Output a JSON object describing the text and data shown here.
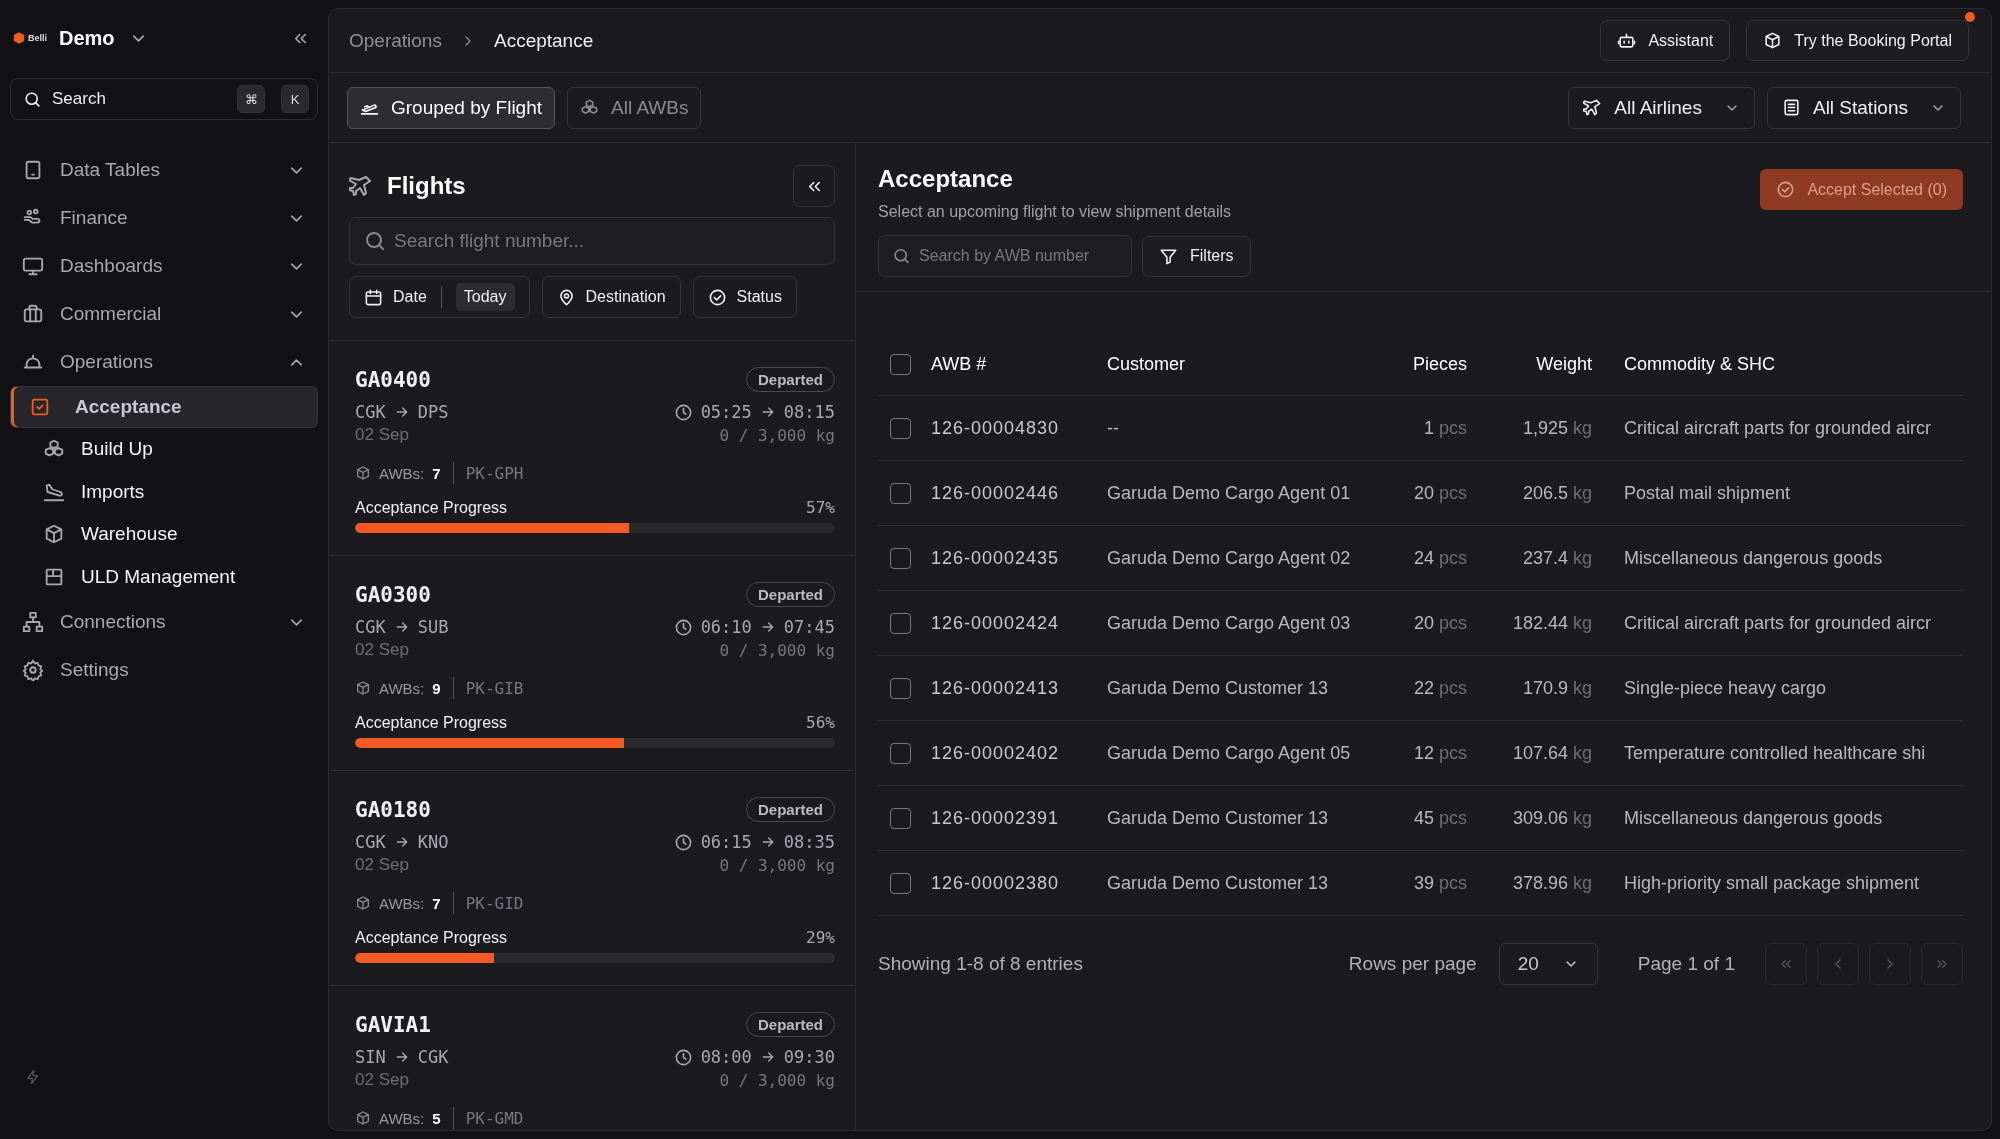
{
  "sidebar": {
    "brand": {
      "logo_text": "Belli",
      "workspace": "Demo"
    },
    "search": {
      "placeholder": "Search",
      "shortcut": [
        "⌘",
        "K"
      ]
    },
    "nav": [
      {
        "label": "Data Tables",
        "expanded": false
      },
      {
        "label": "Finance",
        "expanded": false
      },
      {
        "label": "Dashboards",
        "expanded": false
      },
      {
        "label": "Commercial",
        "expanded": false
      },
      {
        "label": "Operations",
        "expanded": true,
        "children": [
          {
            "label": "Acceptance",
            "selected": true
          },
          {
            "label": "Build Up",
            "selected": false
          },
          {
            "label": "Imports",
            "selected": false
          },
          {
            "label": "Warehouse",
            "selected": false
          },
          {
            "label": "ULD Management",
            "selected": false
          }
        ]
      },
      {
        "label": "Connections",
        "expanded": false
      },
      {
        "label": "Settings"
      }
    ]
  },
  "header": {
    "breadcrumb": [
      "Operations",
      "Acceptance"
    ],
    "actions": [
      {
        "label": "Assistant",
        "notification": false
      },
      {
        "label": "Try the Booking Portal",
        "notification": true
      }
    ]
  },
  "toolbar": {
    "views": [
      {
        "label": "Grouped by Flight",
        "selected": true
      },
      {
        "label": "All AWBs",
        "selected": false
      }
    ],
    "filters": [
      "All Airlines",
      "All Stations"
    ]
  },
  "flights_panel": {
    "title": "Flights",
    "search": {
      "placeholder": "Search flight number..."
    },
    "chips": [
      {
        "label": "Date",
        "value": "Today"
      },
      {
        "label": "Destination"
      },
      {
        "label": "Status"
      }
    ],
    "flights": [
      {
        "code": "GA0400",
        "status": "Departed",
        "from": "CGK",
        "to": "DPS",
        "date": "02 Sep",
        "dep": "05:25",
        "arr": "08:15",
        "load": "0 / 3,000 kg",
        "awbs_label": "AWBs:",
        "awbs": "7",
        "registration": "PK-GPH",
        "progress_label": "Acceptance Progress",
        "progress_value": "57%",
        "level": 0.57
      },
      {
        "code": "GA0300",
        "status": "Departed",
        "from": "CGK",
        "to": "SUB",
        "date": "02 Sep",
        "dep": "06:10",
        "arr": "07:45",
        "load": "0 / 3,000 kg",
        "awbs_label": "AWBs:",
        "awbs": "9",
        "registration": "PK-GIB",
        "progress_label": "Acceptance Progress",
        "progress_value": "56%",
        "level": 0.56
      },
      {
        "code": "GA0180",
        "status": "Departed",
        "from": "CGK",
        "to": "KNO",
        "date": "02 Sep",
        "dep": "06:15",
        "arr": "08:35",
        "load": "0 / 3,000 kg",
        "awbs_label": "AWBs:",
        "awbs": "7",
        "registration": "PK-GID",
        "progress_label": "Acceptance Progress",
        "progress_value": "29%",
        "level": 0.29
      },
      {
        "code": "GAVIA1",
        "status": "Departed",
        "from": "SIN",
        "to": "CGK",
        "date": "02 Sep",
        "dep": "08:00",
        "arr": "09:30",
        "load": "0 / 3,000 kg",
        "awbs_label": "AWBs:",
        "awbs": "5",
        "registration": "PK-GMD"
      }
    ]
  },
  "acceptance": {
    "title": "Acceptance",
    "subtitle": "Select an upcoming flight to view shipment details",
    "accept_button": {
      "label": "Accept Selected (0)",
      "disabled": true
    },
    "search": {
      "placeholder": "Search by AWB number"
    },
    "filters_button": "Filters",
    "table": {
      "select_all": false,
      "columns": [
        "AWB #",
        "Customer",
        "Pieces",
        "Weight",
        "Commodity & SHC"
      ],
      "rows": [
        {
          "checked": false,
          "awb": "126-00004830",
          "customer": "--",
          "pieces": "1",
          "pieces_unit": "pcs",
          "weight": "1,925",
          "weight_unit": "kg",
          "commodity": "Critical aircraft parts for grounded aircr"
        },
        {
          "checked": false,
          "awb": "126-00002446",
          "customer": "Garuda Demo Cargo Agent 01",
          "pieces": "20",
          "pieces_unit": "pcs",
          "weight": "206.5",
          "weight_unit": "kg",
          "commodity": "Postal mail shipment"
        },
        {
          "checked": false,
          "awb": "126-00002435",
          "customer": "Garuda Demo Cargo Agent 02",
          "pieces": "24",
          "pieces_unit": "pcs",
          "weight": "237.4",
          "weight_unit": "kg",
          "commodity": "Miscellaneous dangerous goods"
        },
        {
          "checked": false,
          "awb": "126-00002424",
          "customer": "Garuda Demo Cargo Agent 03",
          "pieces": "20",
          "pieces_unit": "pcs",
          "weight": "182.44",
          "weight_unit": "kg",
          "commodity": "Critical aircraft parts for grounded aircr"
        },
        {
          "checked": false,
          "awb": "126-00002413",
          "customer": "Garuda Demo Customer 13",
          "pieces": "22",
          "pieces_unit": "pcs",
          "weight": "170.9",
          "weight_unit": "kg",
          "commodity": "Single-piece heavy cargo"
        },
        {
          "checked": false,
          "awb": "126-00002402",
          "customer": "Garuda Demo Cargo Agent 05",
          "pieces": "12",
          "pieces_unit": "pcs",
          "weight": "107.64",
          "weight_unit": "kg",
          "commodity": "Temperature controlled healthcare shi"
        },
        {
          "checked": false,
          "awb": "126-00002391",
          "customer": "Garuda Demo Customer 13",
          "pieces": "45",
          "pieces_unit": "pcs",
          "weight": "309.06",
          "weight_unit": "kg",
          "commodity": "Miscellaneous dangerous goods"
        },
        {
          "checked": false,
          "awb": "126-00002380",
          "customer": "Garuda Demo Customer 13",
          "pieces": "39",
          "pieces_unit": "pcs",
          "weight": "378.96",
          "weight_unit": "kg",
          "commodity": "High-priority small package shipment"
        }
      ]
    },
    "footer": {
      "summary": "Showing 1-8 of 8 entries",
      "rows_per_page_label": "Rows per page",
      "rows_per_page": "20",
      "page": "Page 1 of 1",
      "pager": [
        {
          "kind": "first",
          "disabled": true
        },
        {
          "kind": "prev",
          "disabled": true
        },
        {
          "kind": "next",
          "disabled": true
        },
        {
          "kind": "last",
          "disabled": true
        }
      ]
    }
  }
}
